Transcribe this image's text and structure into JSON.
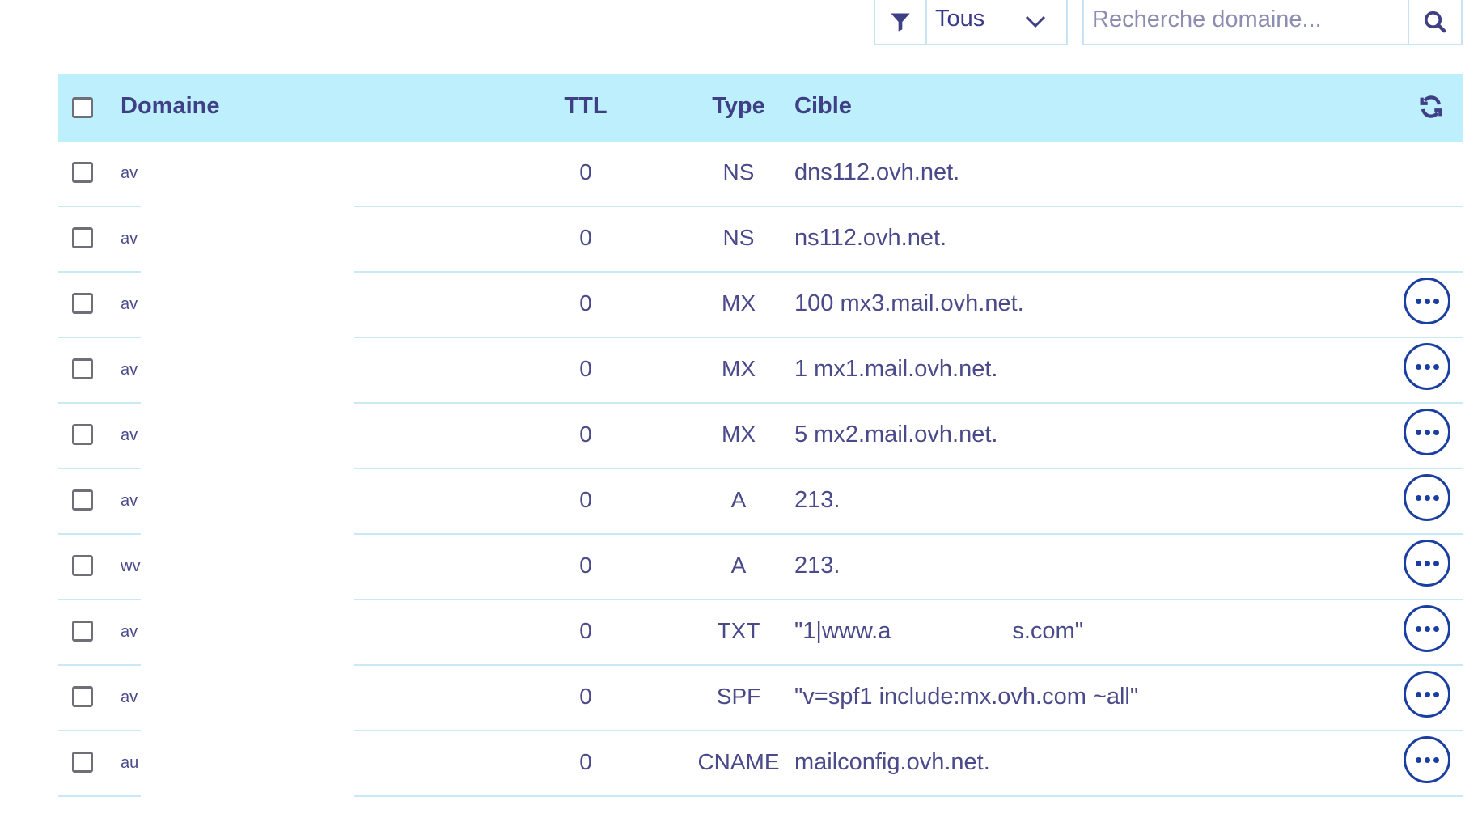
{
  "toolbar": {
    "filter_value": "Tous",
    "search_placeholder": "Recherche domaine..."
  },
  "table": {
    "headers": {
      "domain": "Domaine",
      "ttl": "TTL",
      "type": "Type",
      "target": "Cible"
    },
    "rows": [
      {
        "domain": "av",
        "ttl": "0",
        "type": "NS",
        "target": "dns112.ovh.net."
      },
      {
        "domain": "av",
        "ttl": "0",
        "type": "NS",
        "target": "ns112.ovh.net."
      },
      {
        "domain": "av",
        "ttl": "0",
        "type": "MX",
        "target": "100 mx3.mail.ovh.net."
      },
      {
        "domain": "av",
        "ttl": "0",
        "type": "MX",
        "target": "1 mx1.mail.ovh.net."
      },
      {
        "domain": "av",
        "ttl": "0",
        "type": "MX",
        "target": "5 mx2.mail.ovh.net."
      },
      {
        "domain": "av",
        "ttl": "0",
        "type": "A",
        "target": "213."
      },
      {
        "domain": "wv",
        "ttl": "0",
        "type": "A",
        "target": "213."
      },
      {
        "domain": "av",
        "ttl": "0",
        "type": "TXT",
        "target": "\"1|www.a",
        "target_end": "s.com\""
      },
      {
        "domain": "av",
        "ttl": "0",
        "type": "SPF",
        "target": "\"v=spf1 include:mx.ovh.com ~all\""
      },
      {
        "domain": "au",
        "ttl": "0",
        "type": "CNAME",
        "target": "mailconfig.ovh.net."
      }
    ]
  },
  "colors": {
    "header_bg": "#bdeffd",
    "accent": "#1a3fa0",
    "text": "#4a4a8a"
  }
}
